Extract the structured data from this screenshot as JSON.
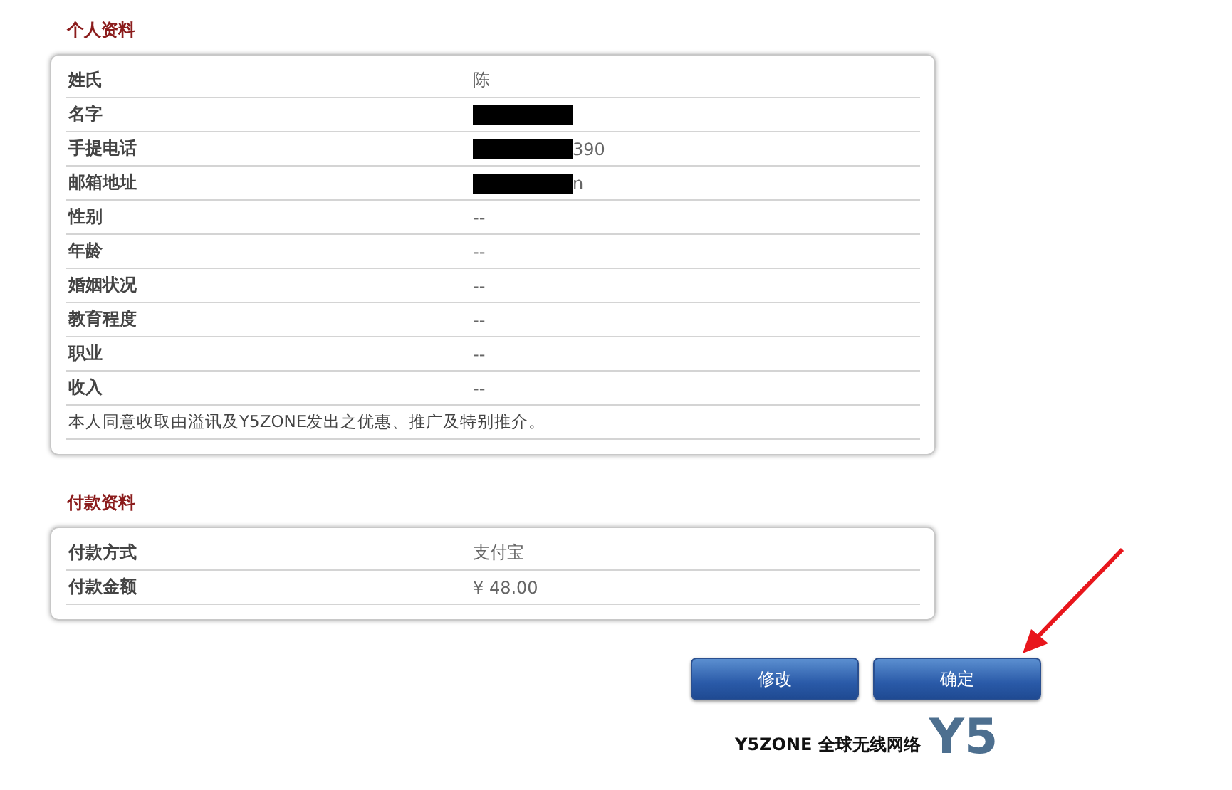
{
  "sections": [
    {
      "title": "个人资料",
      "rows": [
        {
          "label": "姓氏",
          "value": "陈"
        },
        {
          "label": "名字",
          "redacted": true
        },
        {
          "label": "手提电话",
          "value": "390",
          "redacted": true
        },
        {
          "label": "邮箱地址",
          "value": "n",
          "redacted": true
        },
        {
          "label": "性别",
          "value": "--"
        },
        {
          "label": "年龄",
          "value": "--"
        },
        {
          "label": "婚姻状况",
          "value": "--"
        },
        {
          "label": "教育程度",
          "value": "--"
        },
        {
          "label": "职业",
          "value": "--"
        },
        {
          "label": "收入",
          "value": "--"
        }
      ],
      "note": "本人同意收取由溢讯及Y5ZONE发出之优惠、推广及特别推介。"
    },
    {
      "title": "付款资料",
      "rows": [
        {
          "label": "付款方式",
          "value": "支付宝"
        },
        {
          "label": "付款金额",
          "value": "¥ 48.00"
        }
      ]
    }
  ],
  "buttons": [
    "修改",
    "确定"
  ],
  "footer": {
    "brand": "Y5ZONE 全球无线网络",
    "logo": "Y5"
  }
}
